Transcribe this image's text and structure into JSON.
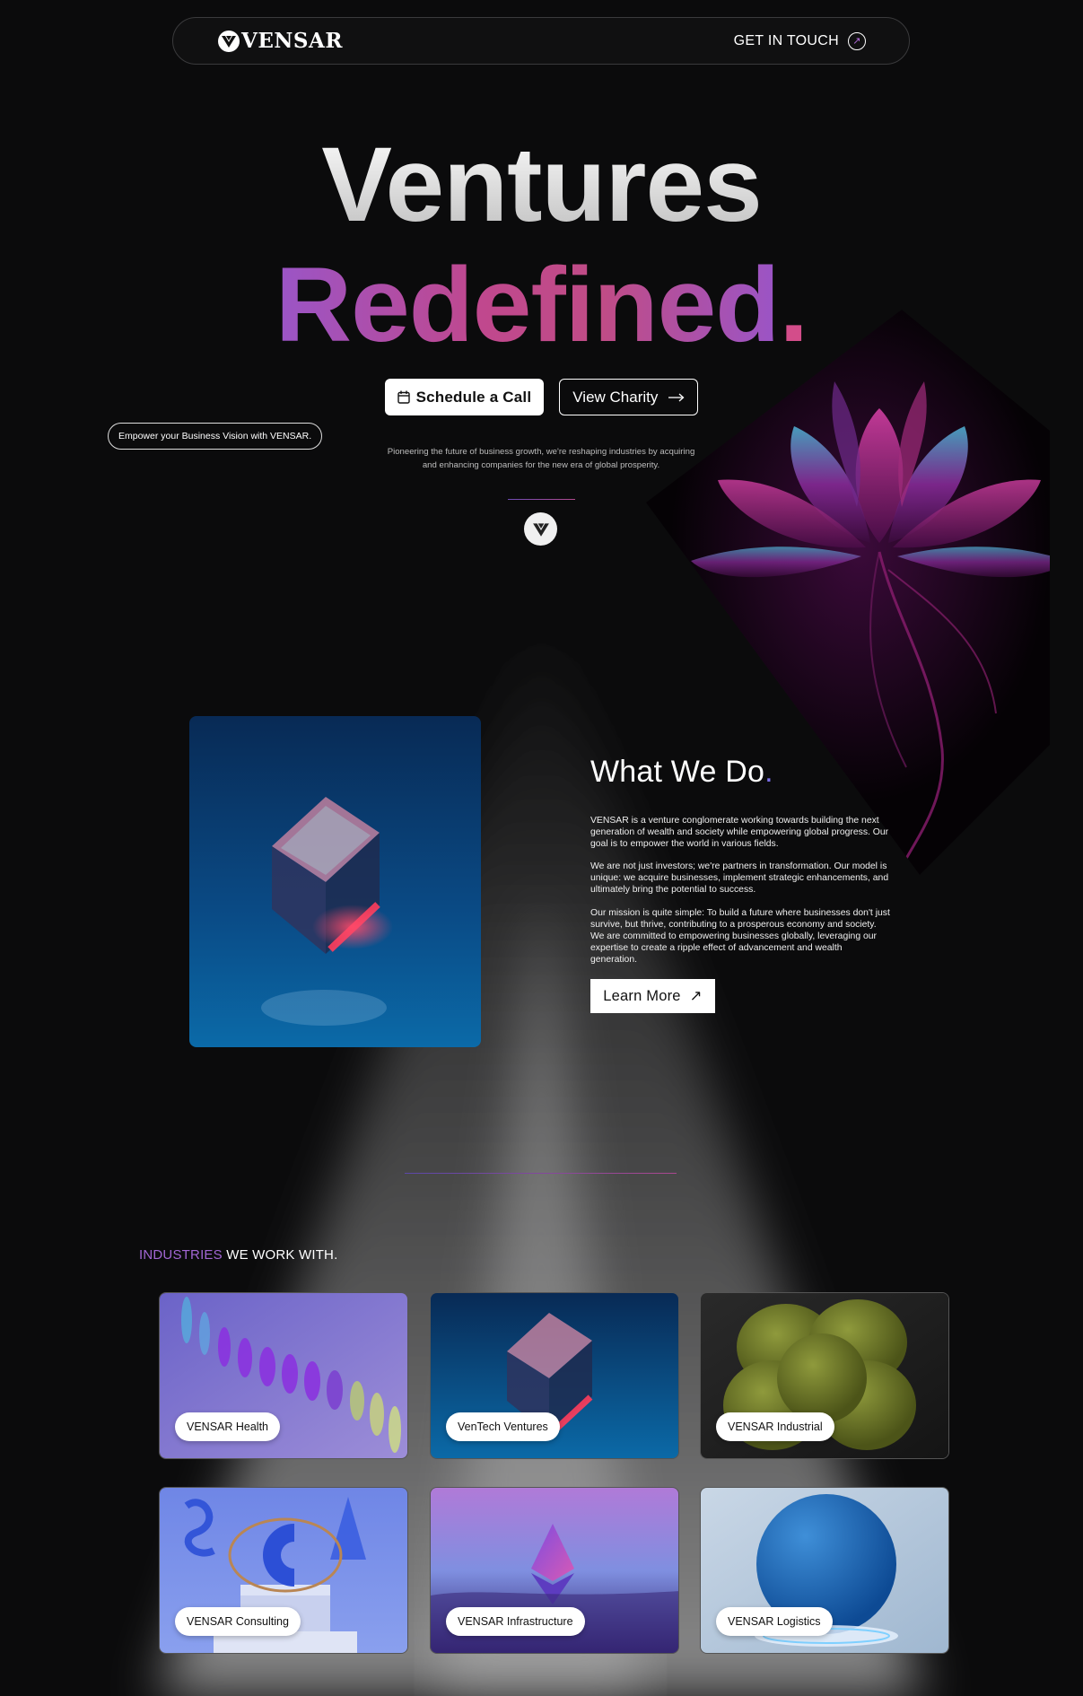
{
  "nav": {
    "brand": "VENSAR",
    "cta_label": "GET IN TOUCH"
  },
  "hero": {
    "headline_line1": "Ventures",
    "headline_line2": "Redefined",
    "headline_dot": ".",
    "schedule_label": "Schedule a Call",
    "charity_label": "View Charity",
    "tagline": "Empower your Business Vision with VENSAR.",
    "description": "Pioneering the future of business growth, we're reshaping industries by acquiring and enhancing companies for the new era of global prosperity."
  },
  "what_we_do": {
    "title": "What We Do",
    "title_dot": ".",
    "paragraphs": [
      "VENSAR is a venture conglomerate working towards building the next generation of wealth and society while empowering global progress. Our goal is to empower the world in various fields.",
      "We are not just investors; we're partners in transformation. Our model is unique: we acquire businesses, implement strategic enhancements, and ultimately bring the potential to success.",
      "Our mission is quite simple: To build a future where businesses don't just survive, but thrive, contributing to a prosperous economy and society. We are committed to empowering businesses globally, leveraging our expertise to create a ripple effect of advancement and wealth generation."
    ],
    "learn_more_label": "Learn More"
  },
  "industries": {
    "title_accent": "INDUSTRIES",
    "title_rest": " WE WORK WITH.",
    "cards": [
      {
        "label": "VENSAR Health",
        "image": "purple-ribbon-spiral"
      },
      {
        "label": "VenTech Ventures",
        "image": "glass-cube"
      },
      {
        "label": "VENSAR Industrial",
        "image": "green-puffy-sphere"
      },
      {
        "label": "VENSAR Consulting",
        "image": "blue-abstract-shapes"
      },
      {
        "label": "VENSAR Infrastructure",
        "image": "ethereum-crystal"
      },
      {
        "label": "VENSAR Logistics",
        "image": "blue-smart-speaker"
      }
    ]
  },
  "colors": {
    "background": "#0b0b0c",
    "accent_purple": "#a266d4",
    "accent_pink": "#d34d8a"
  }
}
